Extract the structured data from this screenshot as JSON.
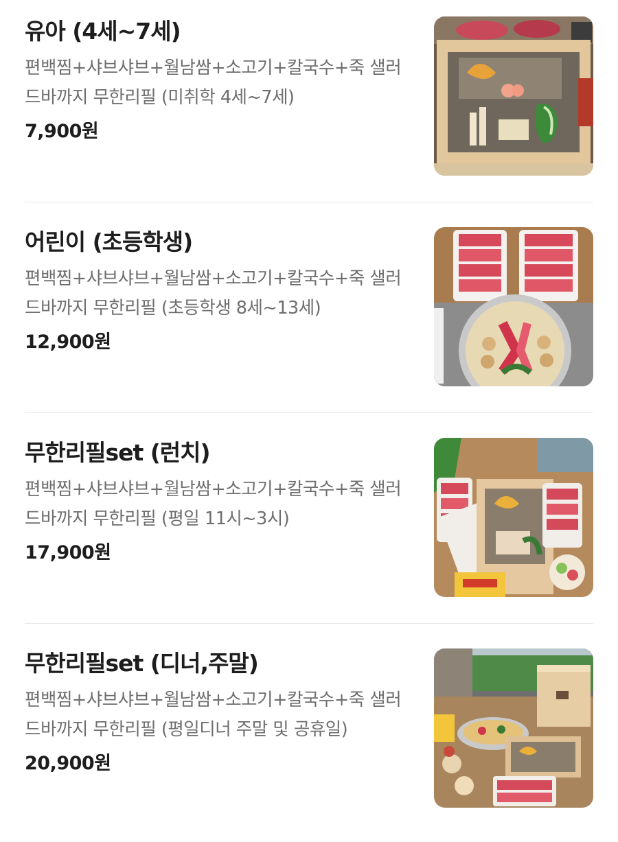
{
  "menu_items": [
    {
      "name": "유아 (4세~7세)",
      "description": "편백찜+샤브샤브+월남쌈+소고기+칼국수+죽 샐러드바까지 무한리필 (미취학 4세~7세)",
      "price": "7,900원"
    },
    {
      "name": "어린이 (초등학생)",
      "description": "편백찜+샤브샤브+월남쌈+소고기+칼국수+죽 샐러드바까지 무한리필 (초등학생 8세~13세)",
      "price": "12,900원"
    },
    {
      "name": "무한리필set (런치)",
      "description": "편백찜+샤브샤브+월남쌈+소고기+칼국수+죽 샐러드바까지 무한리필 (평일 11시~3시)",
      "price": "17,900원"
    },
    {
      "name": "무한리필set (디너,주말)",
      "description": "편백찜+샤브샤브+월남쌈+소고기+칼국수+죽 샐러드바까지 무한리필 (평일디너 주말 및 공휴일)",
      "price": "20,900원"
    }
  ]
}
